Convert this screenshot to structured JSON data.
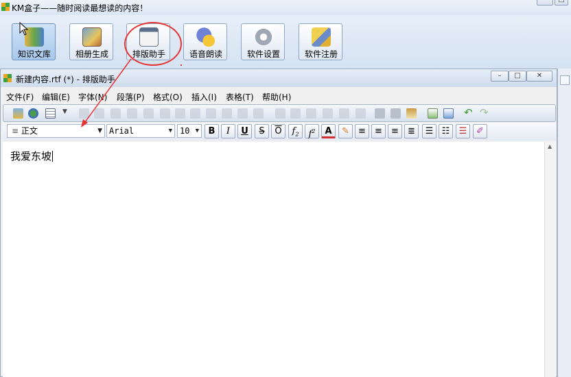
{
  "app": {
    "title": "KM盒子——随时阅读最想读的内容！"
  },
  "main_toolbar": [
    {
      "label": "知识文库",
      "icon": "books-icon"
    },
    {
      "label": "相册生成",
      "icon": "photo-album-icon"
    },
    {
      "label": "排版助手",
      "icon": "layout-icon"
    },
    {
      "label": "语音朗读",
      "icon": "speech-icon"
    },
    {
      "label": "软件设置",
      "icon": "gear-icon"
    },
    {
      "label": "软件注册",
      "icon": "key-icon"
    }
  ],
  "editor": {
    "title": "新建内容.rtf (*) - 排版助手",
    "menu": [
      "文件(F)",
      "编辑(E)",
      "字体(N)",
      "段落(P)",
      "格式(O)",
      "插入(I)",
      "表格(T)",
      "帮助(H)"
    ],
    "style_value": "正文",
    "font_value": "Arial",
    "size_value": "10",
    "format_buttons": {
      "bold": "B",
      "italic": "I",
      "underline": "U",
      "strike": "S",
      "overline": "O",
      "subscript_f": "f",
      "subscript_n": "2",
      "superscript_f": "f",
      "superscript_n": "2",
      "font_color": "A"
    },
    "document_text": "我爱东坡"
  },
  "colors": {
    "highlight": "#e53333",
    "titlebar": "#dbe6f3"
  }
}
